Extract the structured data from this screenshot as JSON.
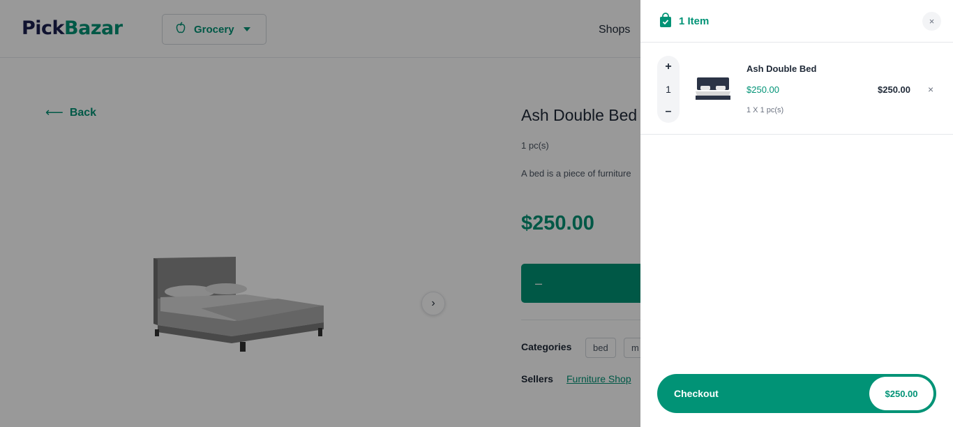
{
  "header": {
    "logo_part1": "Pick",
    "logo_part2": "Bazar",
    "group_label": "Grocery",
    "nav_shops": "Shops"
  },
  "product": {
    "back_label": "Back",
    "title": "Ash Double Bed",
    "unit": "1 pc(s)",
    "description": "A bed is a piece of furniture",
    "price": "$250.00",
    "counter_minus": "–",
    "categories_label": "Categories",
    "categories": [
      "bed",
      "m"
    ],
    "sellers_label": "Sellers",
    "seller": "Furniture Shop"
  },
  "cart": {
    "item_count": "1 Item",
    "close_icon": "×",
    "item": {
      "name": "Ash Double Bed",
      "price": "$250.00",
      "qty_line": "1 X 1 pc(s)",
      "quantity": "1",
      "total": "$250.00",
      "plus": "+",
      "minus": "–",
      "remove": "×"
    },
    "checkout_label": "Checkout",
    "checkout_total": "$250.00"
  },
  "colors": {
    "accent": "#019376",
    "logo_dark": "#1c2150",
    "overlay": "rgba(0,0,0,0.4)"
  },
  "icons": [
    "apple-icon",
    "chevron-down-icon",
    "arrow-left-icon",
    "chevron-right-icon",
    "shopping-bag-icon",
    "close-icon"
  ]
}
